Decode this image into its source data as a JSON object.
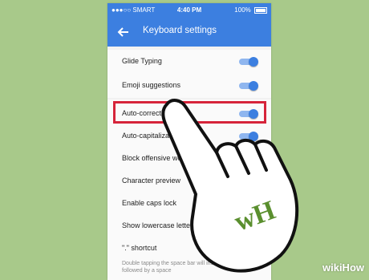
{
  "status_bar": {
    "carrier": "●●●○○ SMART",
    "time": "4:40 PM",
    "battery": "100%"
  },
  "app_bar": {
    "title": "Keyboard settings"
  },
  "settings": [
    {
      "label": "Glide Typing",
      "toggle": "on"
    },
    {
      "label": "Emoji suggestions",
      "toggle": "on"
    },
    {
      "label": "Auto-correction",
      "toggle": "on"
    },
    {
      "label": "Auto-capitalization",
      "toggle": "on"
    },
    {
      "label": "Block offensive words",
      "toggle": "off"
    },
    {
      "label": "Character preview",
      "toggle": "off"
    },
    {
      "label": "Enable caps lock",
      "toggle": "off"
    },
    {
      "label": "Show lowercase letters",
      "toggle": "off"
    },
    {
      "label": "\".\" shortcut",
      "toggle": "on"
    }
  ],
  "footnote": "Double tapping the space bar will insert a period followed by a space",
  "watermark": "wikiHow",
  "colors": {
    "accent": "#3c7fe0",
    "highlight": "#d6243a",
    "background": "#a8c98a"
  }
}
